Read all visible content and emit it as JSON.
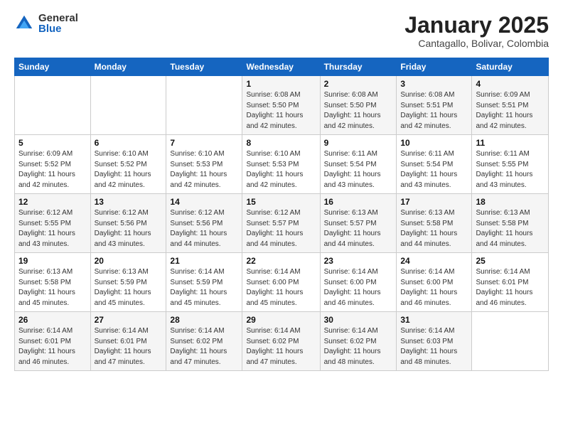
{
  "logo": {
    "general": "General",
    "blue": "Blue"
  },
  "title": "January 2025",
  "location": "Cantagallo, Bolivar, Colombia",
  "headers": [
    "Sunday",
    "Monday",
    "Tuesday",
    "Wednesday",
    "Thursday",
    "Friday",
    "Saturday"
  ],
  "weeks": [
    [
      {
        "day": "",
        "info": ""
      },
      {
        "day": "",
        "info": ""
      },
      {
        "day": "",
        "info": ""
      },
      {
        "day": "1",
        "info": "Sunrise: 6:08 AM\nSunset: 5:50 PM\nDaylight: 11 hours\nand 42 minutes."
      },
      {
        "day": "2",
        "info": "Sunrise: 6:08 AM\nSunset: 5:50 PM\nDaylight: 11 hours\nand 42 minutes."
      },
      {
        "day": "3",
        "info": "Sunrise: 6:08 AM\nSunset: 5:51 PM\nDaylight: 11 hours\nand 42 minutes."
      },
      {
        "day": "4",
        "info": "Sunrise: 6:09 AM\nSunset: 5:51 PM\nDaylight: 11 hours\nand 42 minutes."
      }
    ],
    [
      {
        "day": "5",
        "info": "Sunrise: 6:09 AM\nSunset: 5:52 PM\nDaylight: 11 hours\nand 42 minutes."
      },
      {
        "day": "6",
        "info": "Sunrise: 6:10 AM\nSunset: 5:52 PM\nDaylight: 11 hours\nand 42 minutes."
      },
      {
        "day": "7",
        "info": "Sunrise: 6:10 AM\nSunset: 5:53 PM\nDaylight: 11 hours\nand 42 minutes."
      },
      {
        "day": "8",
        "info": "Sunrise: 6:10 AM\nSunset: 5:53 PM\nDaylight: 11 hours\nand 42 minutes."
      },
      {
        "day": "9",
        "info": "Sunrise: 6:11 AM\nSunset: 5:54 PM\nDaylight: 11 hours\nand 43 minutes."
      },
      {
        "day": "10",
        "info": "Sunrise: 6:11 AM\nSunset: 5:54 PM\nDaylight: 11 hours\nand 43 minutes."
      },
      {
        "day": "11",
        "info": "Sunrise: 6:11 AM\nSunset: 5:55 PM\nDaylight: 11 hours\nand 43 minutes."
      }
    ],
    [
      {
        "day": "12",
        "info": "Sunrise: 6:12 AM\nSunset: 5:55 PM\nDaylight: 11 hours\nand 43 minutes."
      },
      {
        "day": "13",
        "info": "Sunrise: 6:12 AM\nSunset: 5:56 PM\nDaylight: 11 hours\nand 43 minutes."
      },
      {
        "day": "14",
        "info": "Sunrise: 6:12 AM\nSunset: 5:56 PM\nDaylight: 11 hours\nand 44 minutes."
      },
      {
        "day": "15",
        "info": "Sunrise: 6:12 AM\nSunset: 5:57 PM\nDaylight: 11 hours\nand 44 minutes."
      },
      {
        "day": "16",
        "info": "Sunrise: 6:13 AM\nSunset: 5:57 PM\nDaylight: 11 hours\nand 44 minutes."
      },
      {
        "day": "17",
        "info": "Sunrise: 6:13 AM\nSunset: 5:58 PM\nDaylight: 11 hours\nand 44 minutes."
      },
      {
        "day": "18",
        "info": "Sunrise: 6:13 AM\nSunset: 5:58 PM\nDaylight: 11 hours\nand 44 minutes."
      }
    ],
    [
      {
        "day": "19",
        "info": "Sunrise: 6:13 AM\nSunset: 5:58 PM\nDaylight: 11 hours\nand 45 minutes."
      },
      {
        "day": "20",
        "info": "Sunrise: 6:13 AM\nSunset: 5:59 PM\nDaylight: 11 hours\nand 45 minutes."
      },
      {
        "day": "21",
        "info": "Sunrise: 6:14 AM\nSunset: 5:59 PM\nDaylight: 11 hours\nand 45 minutes."
      },
      {
        "day": "22",
        "info": "Sunrise: 6:14 AM\nSunset: 6:00 PM\nDaylight: 11 hours\nand 45 minutes."
      },
      {
        "day": "23",
        "info": "Sunrise: 6:14 AM\nSunset: 6:00 PM\nDaylight: 11 hours\nand 46 minutes."
      },
      {
        "day": "24",
        "info": "Sunrise: 6:14 AM\nSunset: 6:00 PM\nDaylight: 11 hours\nand 46 minutes."
      },
      {
        "day": "25",
        "info": "Sunrise: 6:14 AM\nSunset: 6:01 PM\nDaylight: 11 hours\nand 46 minutes."
      }
    ],
    [
      {
        "day": "26",
        "info": "Sunrise: 6:14 AM\nSunset: 6:01 PM\nDaylight: 11 hours\nand 46 minutes."
      },
      {
        "day": "27",
        "info": "Sunrise: 6:14 AM\nSunset: 6:01 PM\nDaylight: 11 hours\nand 47 minutes."
      },
      {
        "day": "28",
        "info": "Sunrise: 6:14 AM\nSunset: 6:02 PM\nDaylight: 11 hours\nand 47 minutes."
      },
      {
        "day": "29",
        "info": "Sunrise: 6:14 AM\nSunset: 6:02 PM\nDaylight: 11 hours\nand 47 minutes."
      },
      {
        "day": "30",
        "info": "Sunrise: 6:14 AM\nSunset: 6:02 PM\nDaylight: 11 hours\nand 48 minutes."
      },
      {
        "day": "31",
        "info": "Sunrise: 6:14 AM\nSunset: 6:03 PM\nDaylight: 11 hours\nand 48 minutes."
      },
      {
        "day": "",
        "info": ""
      }
    ]
  ]
}
